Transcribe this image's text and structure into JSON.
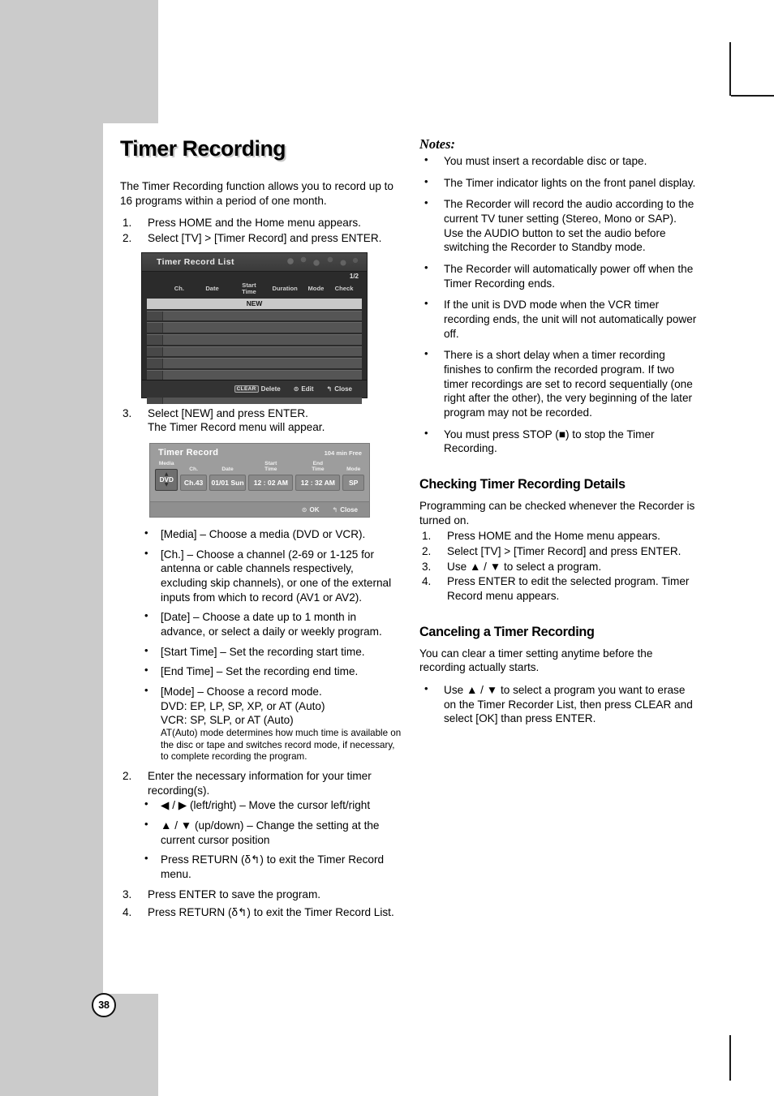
{
  "page": {
    "number": "38"
  },
  "left": {
    "title": "Timer Recording",
    "intro": "The Timer Recording function allows you to record up to 16 programs within a period of one month.",
    "steps_1": [
      {
        "n": "1.",
        "text": "Press HOME and the Home menu appears."
      },
      {
        "n": "2.",
        "text": "Select [TV] > [Timer Record] and press ENTER."
      }
    ],
    "step3_a": "Select [NEW] and press ENTER.",
    "step3_b": "The Timer Record menu will appear.",
    "step3_n": "3.",
    "field_bullets": [
      "[Media] – Choose a media (DVD or VCR).",
      "[Ch.] – Choose a channel (2-69 or 1-125 for antenna or cable channels respectively, excluding skip channels), or one of the external inputs from which to record (AV1 or AV2).",
      "[Date] – Choose a date up to 1 month in advance, or select a daily or weekly program.",
      "[Start Time] – Set the recording start time.",
      "[End Time] – Set the recording end time."
    ],
    "mode_bullet": {
      "main": "[Mode] – Choose a record mode.",
      "dvd": "DVD: EP, LP, SP, XP, or AT (Auto)",
      "vcr": "VCR: SP, SLP, or AT (Auto)",
      "fine": "AT(Auto) mode determines how much time is available on the disc or tape and switches record mode, if necessary, to complete recording the program."
    },
    "step2b": {
      "n": "2.",
      "text": "Enter the necessary information for your timer recording(s)."
    },
    "cursor_bullets": [
      "◀ / ▶ (left/right) – Move the cursor left/right",
      "▲ / ▼ (up/down) – Change the setting at the current cursor position",
      "Press RETURN (δ↰) to exit the Timer Record menu."
    ],
    "steps_end": [
      {
        "n": "3.",
        "text": "Press ENTER to save the program."
      },
      {
        "n": "4.",
        "text": "Press RETURN (δ↰) to exit the Timer Record List."
      }
    ]
  },
  "osd_list": {
    "title": "Timer Record List",
    "page_indicator": "1/2",
    "columns": {
      "ch": "Ch.",
      "date": "Date",
      "start_time_1": "Start",
      "start_time_2": "Time",
      "duration": "Duration",
      "mode": "Mode",
      "check": "Check"
    },
    "new_row": "NEW",
    "empty_row_count": 8,
    "footer": {
      "clear_key": "CLEAR",
      "delete": "Delete",
      "edit_icon": "⊙",
      "edit": "Edit",
      "close_icon": "↰",
      "close": "Close"
    }
  },
  "osd_record": {
    "title": "Timer Record",
    "free_space": "104  min Free",
    "fields": [
      {
        "label": "Media",
        "value": "DVD"
      },
      {
        "label": "Ch.",
        "value": "Ch.43"
      },
      {
        "label": "Date",
        "value": "01/01 Sun"
      },
      {
        "label": "Start\nTime",
        "value": "12 : 02 AM"
      },
      {
        "label": "End\nTime",
        "value": "12 : 32 AM"
      },
      {
        "label": "Mode",
        "value": "SP"
      }
    ],
    "footer": {
      "ok_icon": "⊙",
      "ok": "OK",
      "close_icon": "↰",
      "close": "Close"
    }
  },
  "right": {
    "notes_heading": "Notes:",
    "notes": [
      "You must insert a recordable disc or tape.",
      "The Timer indicator lights on the front panel display.",
      "The Recorder will record the audio according to the current TV tuner setting (Stereo, Mono or SAP). Use the AUDIO button to set the audio before switching the Recorder to Standby mode.",
      "The Recorder will automatically power off when the Timer Recording ends.",
      "If the unit is DVD mode when the VCR timer recording ends, the unit will not automatically power off.",
      "There is a short delay when a timer recording finishes to confirm the recorded program. If two timer recordings are set to record sequentially (one right after the other), the very beginning of the later program may not be recorded.",
      "You must press STOP (■) to stop the Timer Recording."
    ],
    "checking": {
      "heading": "Checking Timer Recording Details",
      "intro": "Programming can be checked whenever the Recorder is turned on.",
      "steps": [
        {
          "n": "1.",
          "text": "Press HOME and the Home menu appears."
        },
        {
          "n": "2.",
          "text": "Select [TV] > [Timer Record] and press ENTER."
        },
        {
          "n": "3.",
          "text": "Use ▲ / ▼ to select a program."
        },
        {
          "n": "4.",
          "text": "Press ENTER to edit the selected program. Timer Record menu appears."
        }
      ]
    },
    "canceling": {
      "heading": "Canceling a Timer Recording",
      "intro": "You can clear a timer setting anytime before the recording actually starts.",
      "bullet": "Use ▲ / ▼ to select a program you want to erase on the Timer Recorder List, then press CLEAR and select [OK] than press ENTER."
    }
  }
}
